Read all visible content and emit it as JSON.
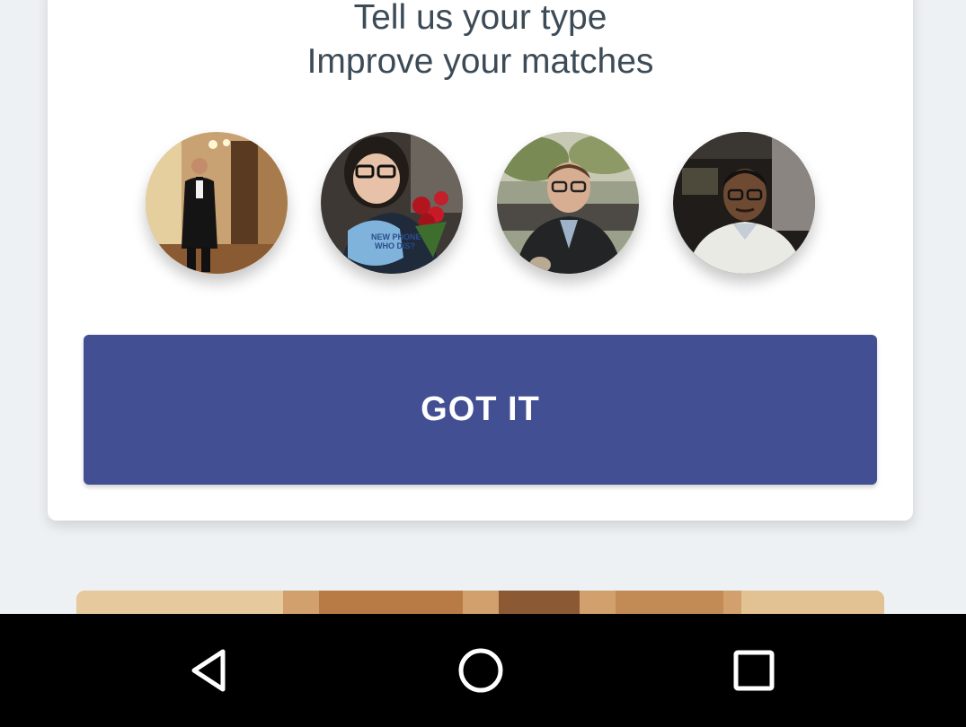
{
  "onboarding_card": {
    "headline_line1": "Tell us your type",
    "headline_line2": "Improve your matches",
    "profile_photos": [
      {
        "label": "profile-photo-tuxedo"
      },
      {
        "label": "profile-photo-roses"
      },
      {
        "label": "profile-photo-puffer-jacket"
      },
      {
        "label": "profile-photo-sweater"
      }
    ],
    "shirt_text_line1": "NEW PHONE",
    "shirt_text_line2": "WHO DIS?",
    "got_it_label": "GOT IT"
  },
  "navigation_bar": {
    "back_icon": "triangle-back-icon",
    "home_icon": "circle-home-icon",
    "recents_icon": "square-recents-icon"
  },
  "colors": {
    "background": "#eef1f4",
    "card": "#ffffff",
    "headline_text": "#3d4b57",
    "primary_button": "#434f93",
    "nav_bar": "#000000"
  }
}
